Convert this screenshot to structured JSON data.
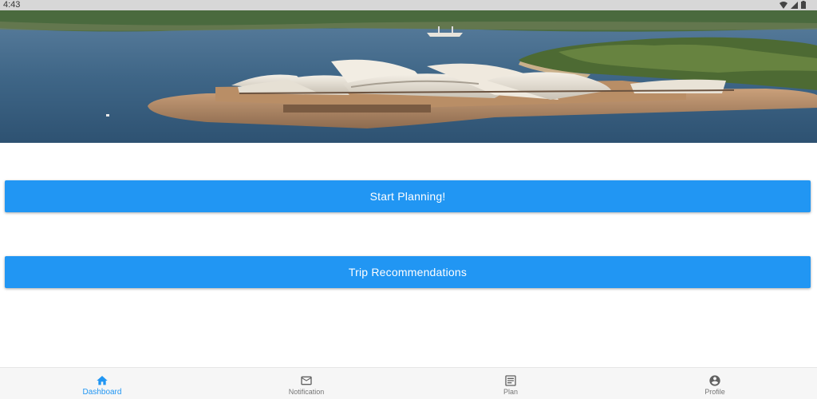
{
  "status_bar": {
    "time": "4:43",
    "icons": [
      "wifi-icon",
      "signal-icon",
      "battery-icon"
    ]
  },
  "hero": {
    "image": "sydney-opera-house-harbour-photo"
  },
  "actions": {
    "start_planning_label": "Start Planning!",
    "trip_recommendations_label": "Trip Recommendations"
  },
  "bottom_nav": {
    "items": [
      {
        "label": "Dashboard",
        "icon": "home-icon",
        "active": true
      },
      {
        "label": "Notification",
        "icon": "mail-icon",
        "active": false
      },
      {
        "label": "Plan",
        "icon": "plan-icon",
        "active": false
      },
      {
        "label": "Profile",
        "icon": "account-circle-icon",
        "active": false
      }
    ]
  },
  "colors": {
    "primary": "#2196f3",
    "inactive": "#757575",
    "status_bar": "#d7d7d7"
  }
}
